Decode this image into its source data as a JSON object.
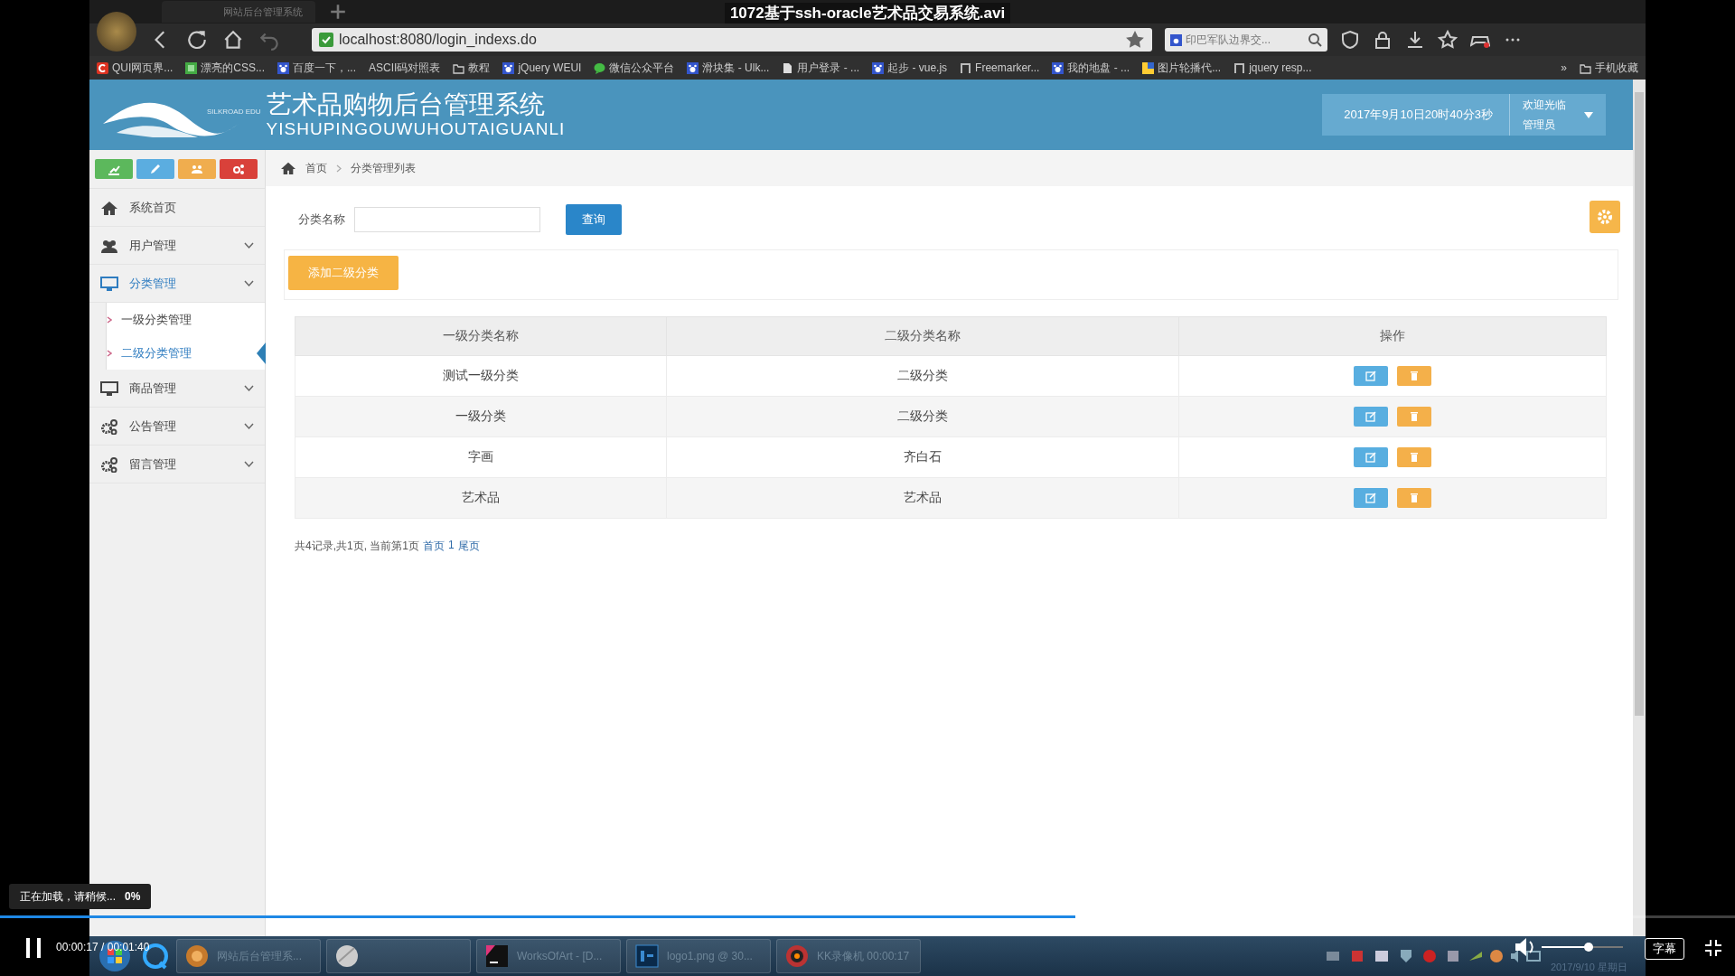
{
  "video": {
    "title": "1072基于ssh-oracle艺术品交易系统.avi",
    "loading": "正在加载，请稍候...",
    "loading_percent": "0%",
    "time": "00:00:17 / 00:01:40",
    "subtitle_button": "字幕",
    "progress": {
      "level": 0.62
    },
    "volume": {
      "level": 0.58
    }
  },
  "browser": {
    "tab": {
      "title": "网站后台管理系统"
    },
    "url": "localhost:8080/login_indexs.do",
    "search": {
      "value": "印巴军队边界交..."
    },
    "bookmarks": [
      {
        "label": "QUI网页界...",
        "kind": "c"
      },
      {
        "label": "漂亮的CSS...",
        "kind": "square"
      },
      {
        "label": "百度一下，...",
        "kind": "paw"
      },
      {
        "label": "ASCII码对照表",
        "kind": "none"
      },
      {
        "label": "教程",
        "kind": "folder"
      },
      {
        "label": "jQuery WEUI",
        "kind": "paw"
      },
      {
        "label": "微信公众平台",
        "kind": "chat"
      },
      {
        "label": "滑块集 - Ulk...",
        "kind": "paw"
      },
      {
        "label": "用户登录 - ...",
        "kind": "doc"
      },
      {
        "label": "起步 - vue.js",
        "kind": "paw"
      },
      {
        "label": "Freemarker...",
        "kind": "bracket"
      },
      {
        "label": "我的地盘 - ...",
        "kind": "paw"
      },
      {
        "label": "图片轮播代...",
        "kind": "image"
      },
      {
        "label": "jquery resp...",
        "kind": "bracket"
      }
    ],
    "more": "»",
    "mobile_bookmarks": "手机收藏"
  },
  "header": {
    "logo_small": "SILKROAD EDU",
    "title": "艺术品购物后台管理系统",
    "subtitle": "YISHUPINGOUWUHOUTAIGUANLI",
    "datetime": "2017年9月10日20时40分3秒",
    "welcome": "欢迎光临",
    "role": "管理员"
  },
  "shortcuts": [
    {
      "kind": "chart",
      "color": "#5cb85c"
    },
    {
      "kind": "pencil",
      "color": "#5bade0"
    },
    {
      "kind": "users",
      "color": "#f0ad4e"
    },
    {
      "kind": "gears",
      "color": "#d9413a"
    }
  ],
  "sidebar": {
    "items": [
      {
        "label": "系统首页",
        "kind": "home",
        "expanded": false,
        "has_arrow": false
      },
      {
        "label": "用户管理",
        "kind": "users",
        "expanded": false,
        "has_arrow": true
      },
      {
        "label": "分类管理",
        "kind": "monitor",
        "expanded": true,
        "has_arrow": true,
        "children": [
          {
            "label": "一级分类管理",
            "selected": false
          },
          {
            "label": "二级分类管理",
            "selected": true
          }
        ]
      },
      {
        "label": "商品管理",
        "kind": "monitor",
        "expanded": false,
        "has_arrow": true
      },
      {
        "label": "公告管理",
        "kind": "gears",
        "expanded": false,
        "has_arrow": true
      },
      {
        "label": "留言管理",
        "kind": "gears",
        "expanded": false,
        "has_arrow": true
      }
    ]
  },
  "breadcrumb": [
    "首页",
    "分类管理列表"
  ],
  "search_form": {
    "label": "分类名称",
    "button": "查询"
  },
  "add_button": "添加二级分类",
  "table": {
    "columns": [
      "一级分类名称",
      "二级分类名称",
      "操作"
    ],
    "rows": [
      {
        "cells": [
          "测试一级分类",
          "二级分类"
        ]
      },
      {
        "cells": [
          "一级分类",
          "二级分类"
        ]
      },
      {
        "cells": [
          "字画",
          "齐白石"
        ]
      },
      {
        "cells": [
          "艺术品",
          "艺术品"
        ]
      }
    ]
  },
  "pagination": {
    "summary": "共4记录,共1页, 当前第1页",
    "links": [
      "首页",
      "1",
      "尾页"
    ]
  },
  "taskbar": {
    "tasks": [
      {
        "label": "网站后台管理系...",
        "kind": "browser"
      },
      {
        "kind": "ball"
      },
      {
        "label": "WorksOfArt - [D...",
        "kind": "ide"
      },
      {
        "label": "logo1.png @ 30...",
        "kind": "ps"
      },
      {
        "label": "KK录像机 00:00:17",
        "kind": "recorder"
      }
    ],
    "date": "2017/9/10 星期日"
  }
}
